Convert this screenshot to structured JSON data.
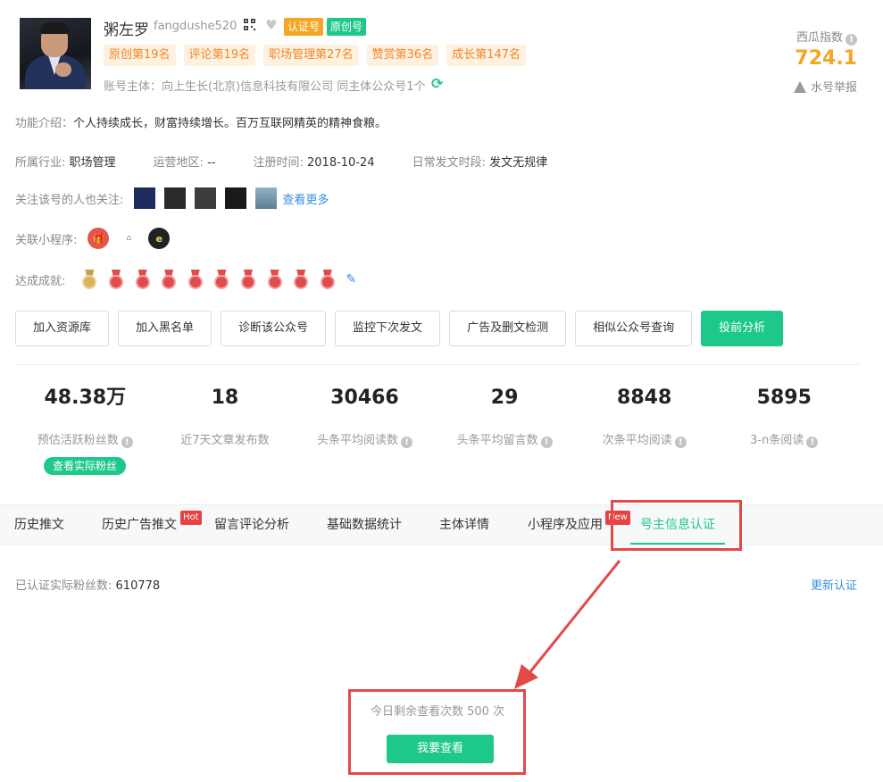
{
  "profile": {
    "name": "粥左罗",
    "wechat_id": "fangdushe520",
    "badge_certified": "认证号",
    "badge_original": "原创号",
    "ranks": [
      "原创第19名",
      "评论第19名",
      "职场管理第27名",
      "赞赏第36名",
      "成长第147名"
    ],
    "owner_text": "账号主体：向上生长(北京)信息科技有限公司 同主体公众号1个"
  },
  "index": {
    "label": "西瓜指数",
    "value": "724.1",
    "report": "水号举报"
  },
  "intro": {
    "label": "功能介绍：",
    "text": "个人持续成长，财富持续增长。百万互联网精英的精神食粮。"
  },
  "meta": {
    "industry_label": "所属行业:",
    "industry": "职场管理",
    "region_label": "运营地区:",
    "region": "--",
    "reg_label": "注册时间:",
    "reg_date": "2018-10-24",
    "post_label": "日常发文时段:",
    "post_time": "发文无规律"
  },
  "follow": {
    "label": "关注该号的人也关注:",
    "more": "查看更多",
    "thumb_colors": [
      "#1f2b5c",
      "#2a2a2a",
      "#3c3c3c",
      "#1a1a1a",
      "#5f7e8f"
    ]
  },
  "mini": {
    "label": "关联小程序:",
    "items": [
      {
        "icon": "gift-icon",
        "color": "#e0574b"
      },
      {
        "icon": "haoshenghuo-logo",
        "color": "#ffffff"
      },
      {
        "icon": "e-logo",
        "color": "#222222"
      }
    ]
  },
  "achievements": {
    "label": "达成成就:",
    "medals": [
      "gold",
      "red",
      "red",
      "red",
      "red",
      "red",
      "red",
      "red",
      "red",
      "red"
    ]
  },
  "buttons": [
    "加入资源库",
    "加入黑名单",
    "诊断该公众号",
    "监控下次发文",
    "广告及删文检测",
    "相似公众号查询",
    "投前分析"
  ],
  "stats": [
    {
      "value": "48.38万",
      "label": "预估活跃粉丝数",
      "info": true
    },
    {
      "value": "18",
      "label": "近7天文章发布数",
      "info": false
    },
    {
      "value": "30466",
      "label": "头条平均阅读数",
      "info": true
    },
    {
      "value": "29",
      "label": "头条平均留言数",
      "info": true
    },
    {
      "value": "8848",
      "label": "次条平均阅读",
      "info": true
    },
    {
      "value": "5895",
      "label": "3-n条阅读",
      "info": true
    }
  ],
  "see_fans": "查看实际粉丝",
  "tabs": [
    {
      "label": "历史推文"
    },
    {
      "label": "历史广告推文",
      "tag": "Hot"
    },
    {
      "label": "留言评论分析"
    },
    {
      "label": "基础数据统计"
    },
    {
      "label": "主体详情"
    },
    {
      "label": "小程序及应用",
      "tag": "New"
    },
    {
      "label": "号主信息认证",
      "active": true
    }
  ],
  "verified": {
    "label": "已认证实际粉丝数:",
    "value": "610778",
    "update": "更新认证"
  },
  "quota": {
    "text": "今日剩余查看次数 500 次",
    "button": "我要查看"
  },
  "colors": {
    "accent": "#1ec88a",
    "orange": "#f5a623",
    "highlight": "#e24a4a",
    "link": "#3a8ee6"
  }
}
